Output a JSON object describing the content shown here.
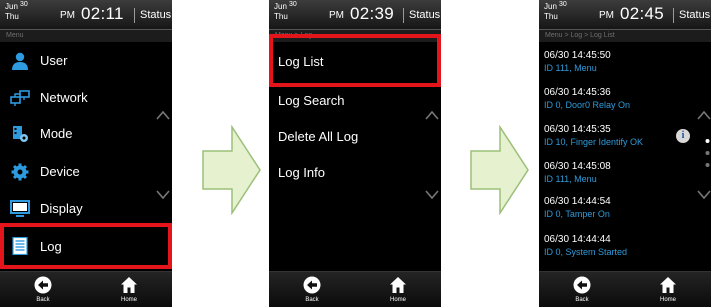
{
  "statusbar": {
    "date_month": "Jun",
    "date_day": "30",
    "date_weekday": "Thu",
    "ampm": "PM",
    "status_label": "Status ▾"
  },
  "screen1": {
    "time": "02:11",
    "breadcrumb": "Menu",
    "items": [
      {
        "label": "User",
        "icon": "user-icon"
      },
      {
        "label": "Network",
        "icon": "network-icon"
      },
      {
        "label": "Mode",
        "icon": "mode-icon"
      },
      {
        "label": "Device",
        "icon": "device-gear-icon"
      },
      {
        "label": "Display",
        "icon": "display-icon"
      },
      {
        "label": "Log",
        "icon": "log-icon"
      }
    ],
    "highlighted": "Log"
  },
  "screen2": {
    "time": "02:39",
    "breadcrumb": "Menu > Log",
    "items": [
      "Log List",
      "Log Search",
      "Delete All Log",
      "Log Info"
    ],
    "highlighted": "Log List"
  },
  "screen3": {
    "time": "02:45",
    "breadcrumb": "Menu > Log > Log List",
    "entries": [
      {
        "datetime": "06/30  14:45:50",
        "desc": "ID  111, Menu"
      },
      {
        "datetime": "06/30  14:45:36",
        "desc": "ID  0, Door0 Relay On"
      },
      {
        "datetime": "06/30  14:45:35",
        "desc": "ID  10, Finger Identify OK"
      },
      {
        "datetime": "06/30  14:45:08",
        "desc": "ID  111, Menu"
      },
      {
        "datetime": "06/30  14:44:54",
        "desc": "ID  0, Tamper On"
      },
      {
        "datetime": "06/30  14:44:44",
        "desc": "ID  0, System Started"
      }
    ],
    "info_symbol": "i"
  },
  "nav": {
    "back_label": "Back",
    "home_label": "Home"
  },
  "colors": {
    "highlight": "#e4141b",
    "log_desc": "#2f9bd9",
    "arrow_fill": "#e6f2cf",
    "icon_blue": "#2e9be0"
  }
}
